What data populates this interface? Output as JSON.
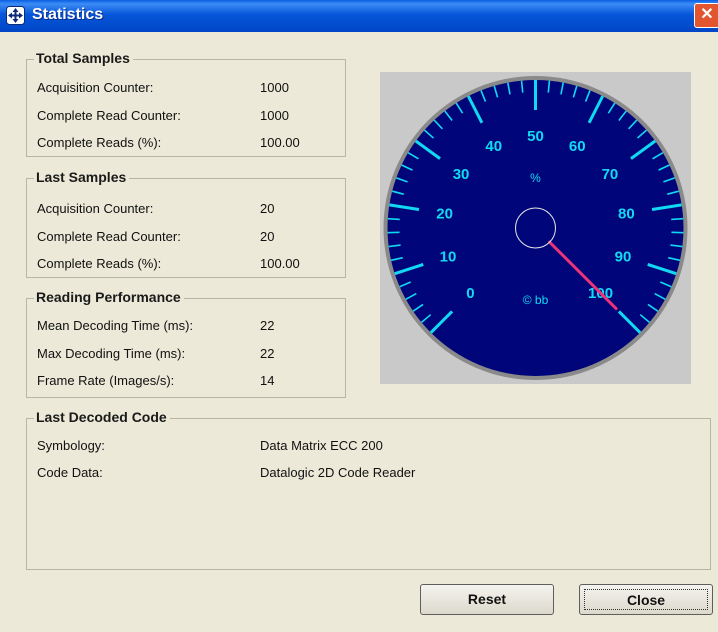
{
  "window": {
    "title": "Statistics",
    "close_glyph": "✕"
  },
  "total_samples": {
    "title": "Total Samples",
    "rows": [
      {
        "label": "Acquisition Counter:",
        "value": "1000"
      },
      {
        "label": "Complete Read Counter:",
        "value": "1000"
      },
      {
        "label": "Complete Reads (%):",
        "value": "100.00"
      }
    ]
  },
  "last_samples": {
    "title": "Last Samples",
    "rows": [
      {
        "label": "Acquisition Counter:",
        "value": "20"
      },
      {
        "label": "Complete Read Counter:",
        "value": "20"
      },
      {
        "label": "Complete Reads (%):",
        "value": "100.00"
      }
    ]
  },
  "reading_performance": {
    "title": "Reading Performance",
    "rows": [
      {
        "label": "Mean Decoding Time (ms):",
        "value": "22"
      },
      {
        "label": "Max Decoding Time (ms):",
        "value": "22"
      },
      {
        "label": "Frame Rate (Images/s):",
        "value": "14"
      }
    ]
  },
  "last_decoded_code": {
    "title": "Last Decoded Code",
    "rows": [
      {
        "label": "Symbology:",
        "value": "Data Matrix ECC 200"
      },
      {
        "label": "Code Data:",
        "value": "Datalogic 2D Code Reader"
      }
    ]
  },
  "gauge": {
    "unit_label": "%",
    "brand_label": "© bb",
    "value": 100,
    "min": 0,
    "max": 100,
    "major_labels": [
      "0",
      "10",
      "20",
      "30",
      "40",
      "50",
      "60",
      "70",
      "80",
      "90",
      "100"
    ],
    "colors": {
      "face": "#00067a",
      "tick": "#12d9f2",
      "needle": "#e8327a",
      "rim": "#8a8a8a"
    }
  },
  "buttons": {
    "reset": "Reset",
    "close": "Close"
  }
}
